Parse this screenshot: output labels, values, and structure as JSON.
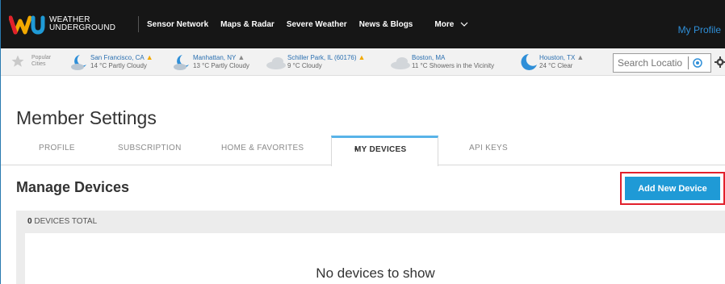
{
  "nav": {
    "logo_line1": "WEATHER",
    "logo_line2": "UNDERGROUND",
    "items": [
      "Sensor Network",
      "Maps & Radar",
      "Severe Weather",
      "News & Blogs"
    ],
    "more_label": "More",
    "profile_label": "My Profile"
  },
  "citybar": {
    "popular_label": "Popular Cities",
    "cities": [
      {
        "name": "San Francisco, CA",
        "weather": "14 °C Partly Cloudy",
        "icon": "partly-cloudy-night-icon",
        "alert": true
      },
      {
        "name": "Manhattan, NY",
        "weather": "13 °C Partly Cloudy",
        "icon": "partly-cloudy-night-icon",
        "alert": true
      },
      {
        "name": "Schiller Park, IL (60176)",
        "weather": "9 °C Cloudy",
        "icon": "cloud-icon",
        "alert": true
      },
      {
        "name": "Boston, MA",
        "weather": "11 °C Showers in the Vicinity",
        "icon": "cloud-icon",
        "alert": false
      },
      {
        "name": "Houston, TX",
        "weather": "24 °C Clear",
        "icon": "moon-icon",
        "alert": true
      }
    ],
    "search_placeholder": "Search Locatio"
  },
  "page": {
    "title": "Member Settings",
    "tabs": [
      "PROFILE",
      "SUBSCRIPTION",
      "HOME & FAVORITES",
      "MY DEVICES",
      "API KEYS"
    ],
    "active_tab": "MY DEVICES",
    "section_title": "Manage Devices",
    "add_button": "Add New Device",
    "devices_count": "0",
    "devices_total_label": "DEVICES TOTAL",
    "empty_message": "No devices to show"
  },
  "colors": {
    "nav_bg": "#161616",
    "accent_blue": "#1f9ad6",
    "highlight_red": "#e2202c",
    "tab_active_border": "#58b3e8",
    "alert_yellow": "#f2a900"
  }
}
